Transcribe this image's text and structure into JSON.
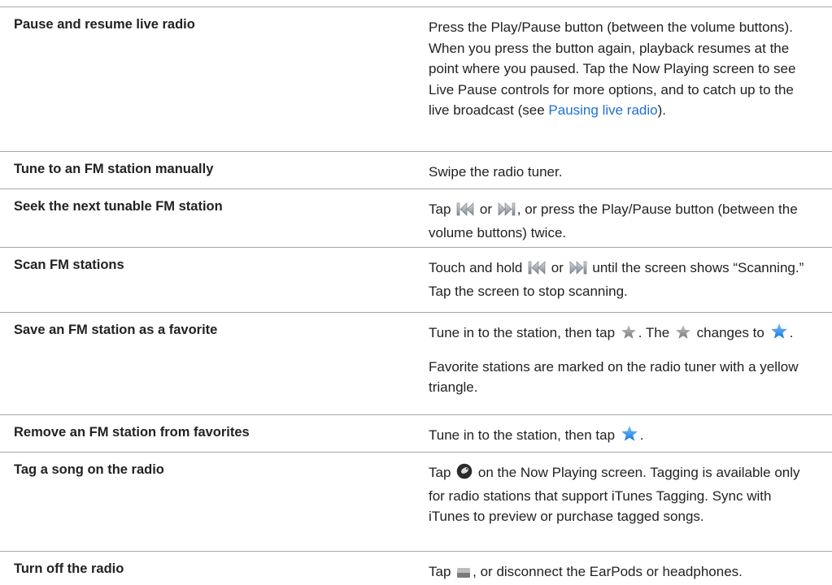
{
  "rows": [
    {
      "action": "Pause and resume live radio",
      "desc": {
        "text": "Press the Play/Pause button (between the volume buttons). When you press the button again, playback resumes at the point where you paused. Tap the Now Playing screen to see Live Pause controls for more options, and to catch up to the live broadcast (see ",
        "link": "Pausing live radio",
        "after": ")."
      }
    },
    {
      "action": "Tune to an FM station manually",
      "desc": {
        "text": "Swipe the radio tuner."
      }
    },
    {
      "action": "Seek the next tunable FM station",
      "desc": {
        "pre": "Tap",
        "mid": "or",
        "post": ", or press the Play/Pause button (between the volume buttons) twice."
      }
    },
    {
      "action": "Scan FM stations",
      "desc": {
        "pre": "Touch and hold",
        "mid": "or",
        "post": "until the screen shows “Scanning.” Tap the screen to stop scanning."
      }
    },
    {
      "action": "Save an FM station as a favorite",
      "desc": {
        "pre": "Tune in to the station, then tap",
        "mid": ". The",
        "mid2": "changes to",
        "post": ".",
        "note": "Favorite stations are marked on the radio tuner with a yellow triangle."
      }
    },
    {
      "action": "Remove an FM station from favorites",
      "desc": {
        "pre": "Tune in to the station, then tap",
        "post": "."
      }
    },
    {
      "action": "Tag a song on the radio",
      "desc": {
        "pre": "Tap",
        "post": "on the Now Playing screen. Tagging is available only for radio stations that support iTunes Tagging. Sync with iTunes to preview or purchase tagged songs."
      }
    },
    {
      "action": "Turn off the radio",
      "desc": {
        "pre": "Tap",
        "post": ", or disconnect the EarPods or headphones."
      }
    }
  ],
  "icons": {
    "previous": "previous-track-icon",
    "next": "next-track-icon",
    "star_gray": "star-outline-gray-icon",
    "star_blue": "star-favorite-blue-icon",
    "tag": "tag-icon",
    "off": "radio-off-icon"
  },
  "colors": {
    "link": "#1e6fd6",
    "star_gray": "#8c8c8c",
    "star_blue": "#2f8fe8",
    "rule": "#a7a7a7"
  }
}
